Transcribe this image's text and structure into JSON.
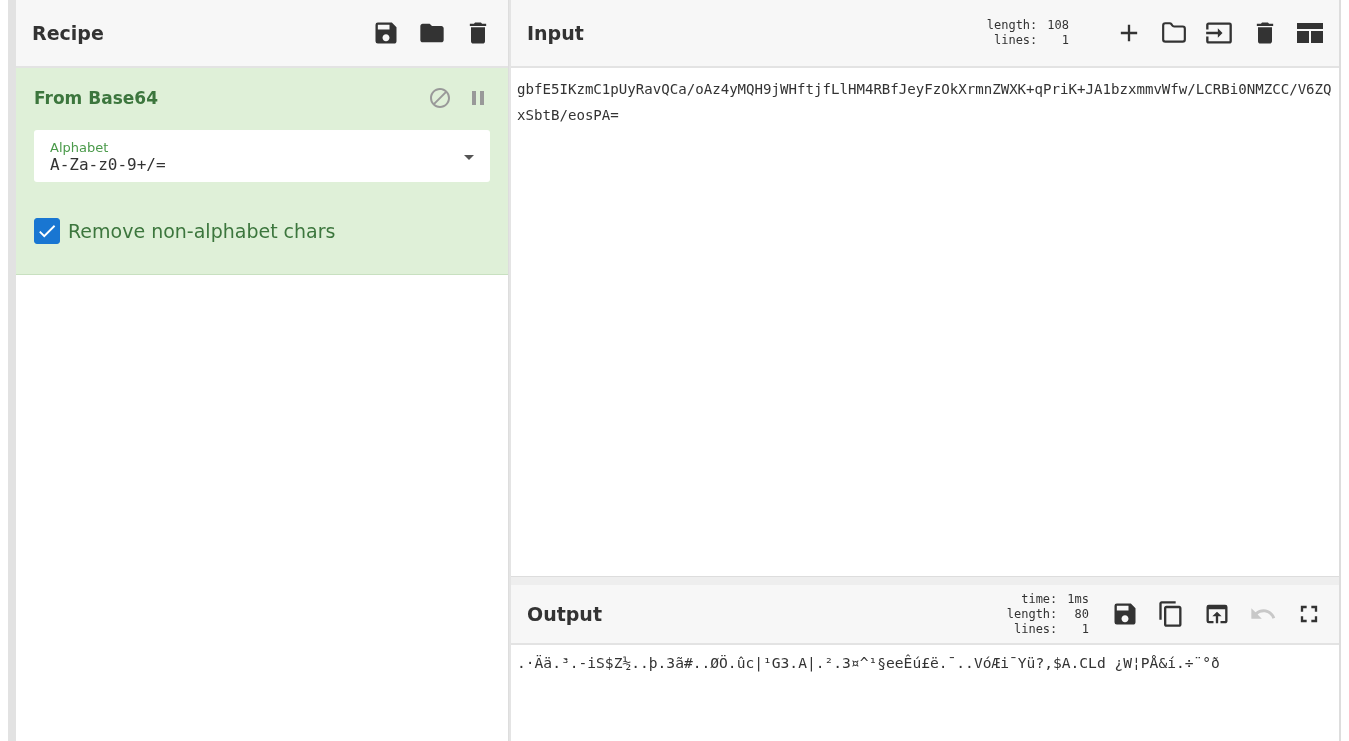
{
  "recipe": {
    "title": "Recipe",
    "operations": [
      {
        "title": "From Base64",
        "args": [
          {
            "kind": "dropdown",
            "label": "Alphabet",
            "value": "A-Za-z0-9+/="
          },
          {
            "kind": "checkbox",
            "label": "Remove non-alphabet chars",
            "checked": true
          }
        ]
      }
    ]
  },
  "input": {
    "title": "Input",
    "stats": [
      {
        "label": "length:",
        "value": "108"
      },
      {
        "label": "lines:",
        "value": "1"
      }
    ],
    "text": "gbfE5IKzmC1pUyRavQCa/oAz4yMQH9jWHftjfLlHM4RBfJeyFzOkXrmnZWXK+qPriK+JA1bzxmmvWfw/LCRBi0NMZCC/V6ZQxSbtB/eosPA="
  },
  "output": {
    "title": "Output",
    "stats": [
      {
        "label": "time:",
        "value": "1ms"
      },
      {
        "label": "length:",
        "value": "80"
      },
      {
        "label": "lines:",
        "value": "1"
      }
    ],
    "tools": [
      {
        "kind": "save",
        "disabled": false
      },
      {
        "kind": "copy",
        "disabled": false
      },
      {
        "kind": "replace",
        "disabled": false
      },
      {
        "kind": "undo",
        "disabled": true
      },
      {
        "kind": "maximise",
        "disabled": false
      }
    ],
    "text": ".·Ää.³.-iS$Z½..þ.3ã#..ØÖ.ûc|¹G3.A|.².3¤^¹§eeÊú£ë.¯..VóÆi¯Yü?,$A.CLd ¿W¦PÅ&í.÷¨°ð"
  }
}
